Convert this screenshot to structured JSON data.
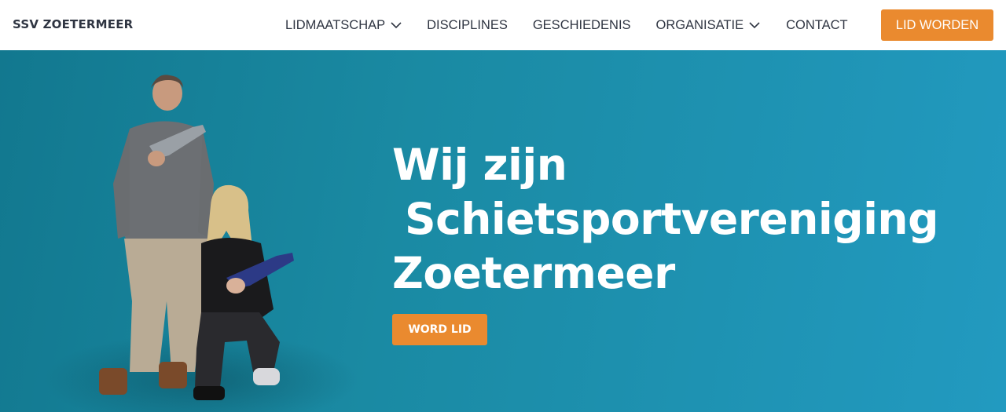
{
  "header": {
    "brand": "SSV ZOETERMEER",
    "menu": [
      {
        "label": "LIDMAATSCHAP",
        "icon": "chevron-down-icon"
      },
      {
        "label": "DISCIPLINES"
      },
      {
        "label": "GESCHIEDENIS"
      },
      {
        "label": "ORGANISATIE",
        "icon": "chevron-down-icon"
      },
      {
        "label": "CONTACT"
      }
    ],
    "cta_label": "LID WORDEN"
  },
  "hero": {
    "headline": [
      "Wij zijn",
      "Schietsportvereniging",
      "Zoetermeer"
    ],
    "cta_label": "WORD LID",
    "photo": "two-shooters-photo"
  },
  "colors": {
    "accent": "#ea8a2f",
    "hero_background": "#1a8aa3",
    "nav_text": "#2f3542"
  }
}
